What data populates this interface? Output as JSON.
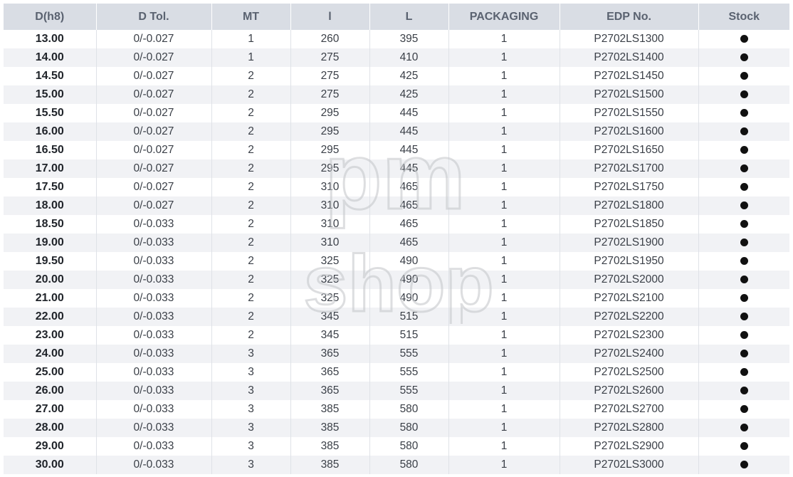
{
  "columns": [
    "D(h8)",
    "D Tol.",
    "MT",
    "l",
    "L",
    "PACKAGING",
    "EDP No.",
    "Stock"
  ],
  "rows": [
    {
      "d": "13.00",
      "tol": "0/-0.027",
      "mt": "1",
      "l": "260",
      "L": "395",
      "pack": "1",
      "edp": "P2702LS1300",
      "stock": "●"
    },
    {
      "d": "14.00",
      "tol": "0/-0.027",
      "mt": "1",
      "l": "275",
      "L": "410",
      "pack": "1",
      "edp": "P2702LS1400",
      "stock": "●"
    },
    {
      "d": "14.50",
      "tol": "0/-0.027",
      "mt": "2",
      "l": "275",
      "L": "425",
      "pack": "1",
      "edp": "P2702LS1450",
      "stock": "●"
    },
    {
      "d": "15.00",
      "tol": "0/-0.027",
      "mt": "2",
      "l": "275",
      "L": "425",
      "pack": "1",
      "edp": "P2702LS1500",
      "stock": "●"
    },
    {
      "d": "15.50",
      "tol": "0/-0.027",
      "mt": "2",
      "l": "295",
      "L": "445",
      "pack": "1",
      "edp": "P2702LS1550",
      "stock": "●"
    },
    {
      "d": "16.00",
      "tol": "0/-0.027",
      "mt": "2",
      "l": "295",
      "L": "445",
      "pack": "1",
      "edp": "P2702LS1600",
      "stock": "●"
    },
    {
      "d": "16.50",
      "tol": "0/-0.027",
      "mt": "2",
      "l": "295",
      "L": "445",
      "pack": "1",
      "edp": "P2702LS1650",
      "stock": "●"
    },
    {
      "d": "17.00",
      "tol": "0/-0.027",
      "mt": "2",
      "l": "295",
      "L": "445",
      "pack": "1",
      "edp": "P2702LS1700",
      "stock": "●"
    },
    {
      "d": "17.50",
      "tol": "0/-0.027",
      "mt": "2",
      "l": "310",
      "L": "465",
      "pack": "1",
      "edp": "P2702LS1750",
      "stock": "●"
    },
    {
      "d": "18.00",
      "tol": "0/-0.027",
      "mt": "2",
      "l": "310",
      "L": "465",
      "pack": "1",
      "edp": "P2702LS1800",
      "stock": "●"
    },
    {
      "d": "18.50",
      "tol": "0/-0.033",
      "mt": "2",
      "l": "310",
      "L": "465",
      "pack": "1",
      "edp": "P2702LS1850",
      "stock": "●"
    },
    {
      "d": "19.00",
      "tol": "0/-0.033",
      "mt": "2",
      "l": "310",
      "L": "465",
      "pack": "1",
      "edp": "P2702LS1900",
      "stock": "●"
    },
    {
      "d": "19.50",
      "tol": "0/-0.033",
      "mt": "2",
      "l": "325",
      "L": "490",
      "pack": "1",
      "edp": "P2702LS1950",
      "stock": "●"
    },
    {
      "d": "20.00",
      "tol": "0/-0.033",
      "mt": "2",
      "l": "325",
      "L": "490",
      "pack": "1",
      "edp": "P2702LS2000",
      "stock": "●"
    },
    {
      "d": "21.00",
      "tol": "0/-0.033",
      "mt": "2",
      "l": "325",
      "L": "490",
      "pack": "1",
      "edp": "P2702LS2100",
      "stock": "●"
    },
    {
      "d": "22.00",
      "tol": "0/-0.033",
      "mt": "2",
      "l": "345",
      "L": "515",
      "pack": "1",
      "edp": "P2702LS2200",
      "stock": "●"
    },
    {
      "d": "23.00",
      "tol": "0/-0.033",
      "mt": "2",
      "l": "345",
      "L": "515",
      "pack": "1",
      "edp": "P2702LS2300",
      "stock": "●"
    },
    {
      "d": "24.00",
      "tol": "0/-0.033",
      "mt": "3",
      "l": "365",
      "L": "555",
      "pack": "1",
      "edp": "P2702LS2400",
      "stock": "●"
    },
    {
      "d": "25.00",
      "tol": "0/-0.033",
      "mt": "3",
      "l": "365",
      "L": "555",
      "pack": "1",
      "edp": "P2702LS2500",
      "stock": "●"
    },
    {
      "d": "26.00",
      "tol": "0/-0.033",
      "mt": "3",
      "l": "365",
      "L": "555",
      "pack": "1",
      "edp": "P2702LS2600",
      "stock": "●"
    },
    {
      "d": "27.00",
      "tol": "0/-0.033",
      "mt": "3",
      "l": "385",
      "L": "580",
      "pack": "1",
      "edp": "P2702LS2700",
      "stock": "●"
    },
    {
      "d": "28.00",
      "tol": "0/-0.033",
      "mt": "3",
      "l": "385",
      "L": "580",
      "pack": "1",
      "edp": "P2702LS2800",
      "stock": "●"
    },
    {
      "d": "29.00",
      "tol": "0/-0.033",
      "mt": "3",
      "l": "385",
      "L": "580",
      "pack": "1",
      "edp": "P2702LS2900",
      "stock": "●"
    },
    {
      "d": "30.00",
      "tol": "0/-0.033",
      "mt": "3",
      "l": "385",
      "L": "580",
      "pack": "1",
      "edp": "P2702LS3000",
      "stock": "●"
    }
  ],
  "watermark": {
    "line1": "pm",
    "line2": "shop"
  },
  "colors": {
    "header_bg": "#d9dde4",
    "header_text": "#5a6270",
    "row_alt": "#f1f2f5",
    "stock_dot": "#111111"
  }
}
